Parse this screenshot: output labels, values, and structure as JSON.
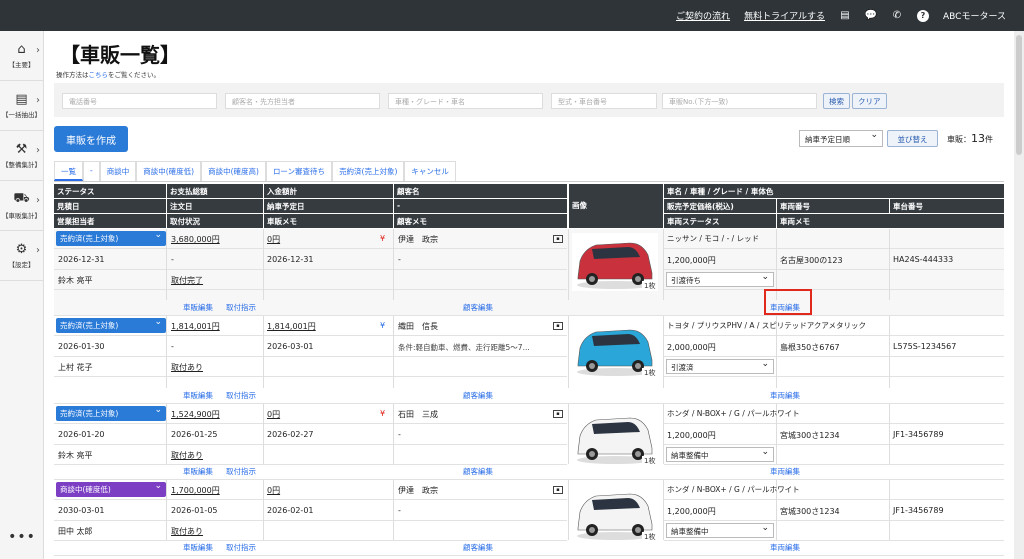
{
  "topbar": {
    "contract": "ご契約の流れ",
    "trial": "無料トライアルする",
    "company": "ABCモータース"
  },
  "sidebar": [
    {
      "label": "【主要】",
      "icon": "home-icon"
    },
    {
      "label": "【一括抽出】",
      "icon": "document-icon"
    },
    {
      "label": "【整備集計】",
      "icon": "wrench-icon"
    },
    {
      "label": "【車販集計】",
      "icon": "car-icon"
    },
    {
      "label": "【設定】",
      "icon": "gear-icon"
    }
  ],
  "page": {
    "title": "【車販一覧】",
    "help_prefix": "操作方法は",
    "help_link": "こちら",
    "help_suffix": "をご覧ください。"
  },
  "search": {
    "phone": "電話番号",
    "customer": "顧客名・先方担当者",
    "vehicle": "車種・グレード・車名",
    "model": "型式・車台番号",
    "car_no": "車販No.(下方一致)",
    "search_btn": "検索",
    "clear_btn": "クリア"
  },
  "create_btn": "車販を作成",
  "sort": {
    "selected": "納車予定日順",
    "button": "並び替え",
    "count_label": "車販：",
    "count": "13",
    "count_unit": "件"
  },
  "tabs": [
    "一覧",
    "-",
    "商談中",
    "商談中(確度低)",
    "商談中(確度高)",
    "ローン審査待ち",
    "売約済(売上対象)",
    "キャンセル"
  ],
  "headers": {
    "r1": [
      "ステータス",
      "お支払総額",
      "入金額計",
      "顧客名",
      "画像",
      "車名 / 車種 / グレード / 車体色"
    ],
    "r2": [
      "見積日",
      "注文日",
      "納車予定日",
      "-",
      "販売予定価格(税込)",
      "車両番号",
      "車台番号"
    ],
    "r3": [
      "営業担当者",
      "取付状況",
      "車販メモ",
      "顧客メモ",
      "車両ステータス",
      "車両メモ"
    ]
  },
  "links": {
    "sale_edit": "車販編集",
    "install": "取付指示",
    "cust_edit": "顧客編集",
    "veh_edit": "車両編集"
  },
  "rows": [
    {
      "status": "売約済(売上対象)",
      "total": "3,680,000円",
      "paid": "0円",
      "yen": "¥",
      "customer": "伊達　政宗",
      "estimate": "2026-12-31",
      "order": "-",
      "delivery": "2026-12-31",
      "cust_note": "-",
      "staff": "鈴木 亮平",
      "install": "取付完了",
      "memo": "",
      "cust_memo": "",
      "car": "ニッサン / モコ / - / レッド",
      "price": "1,200,000円",
      "plate": "名古屋300の123",
      "chassis": "HA24S-444333",
      "vstatus": "引渡待ち",
      "count": "1枚"
    },
    {
      "status": "売約済(売上対象)",
      "total": "1,814,001円",
      "paid": "1,814,001円",
      "yen": "¥",
      "customer": "織田　信長",
      "estimate": "2026-01-30",
      "order": "-",
      "delivery": "2026-03-01",
      "cust_note": "条件:軽自動車、燃費、走行距離5～7...",
      "staff": "上村 花子",
      "install": "取付あり",
      "memo": "",
      "cust_memo": "",
      "car": "トヨタ / プリウスPHV / A / スピリテッドアクアメタリック",
      "price": "2,000,000円",
      "plate": "島根350さ6767",
      "chassis": "L575S-1234567",
      "vstatus": "引渡済",
      "count": "1枚"
    },
    {
      "status": "売約済(売上対象)",
      "total": "1,524,900円",
      "paid": "0円",
      "yen": "¥",
      "customer": "石田　三成",
      "estimate": "2026-01-20",
      "order": "2026-01-25",
      "delivery": "2026-02-27",
      "cust_note": "-",
      "staff": "鈴木 亮平",
      "install": "取付あり",
      "memo": "",
      "cust_memo": "",
      "car": "ホンダ / N-BOX+ / G / パールホワイト",
      "price": "1,200,000円",
      "plate": "宮城300さ1234",
      "chassis": "JF1-3456789",
      "vstatus": "納車整備中",
      "count": "1枚"
    },
    {
      "status": "商談中(確度低)",
      "total": "1,700,000円",
      "paid": "0円",
      "yen": "",
      "customer": "伊達　政宗",
      "estimate": "2030-03-01",
      "order": "2026-01-05",
      "delivery": "2026-02-01",
      "cust_note": "-",
      "staff": "田中 太郎",
      "install": "取付あり",
      "memo": "",
      "cust_memo": "",
      "car": "ホンダ / N-BOX+ / G / パールホワイト",
      "price": "1,200,000円",
      "plate": "宮城300さ1234",
      "chassis": "JF1-3456789",
      "vstatus": "納車整備中",
      "count": "1枚"
    }
  ]
}
